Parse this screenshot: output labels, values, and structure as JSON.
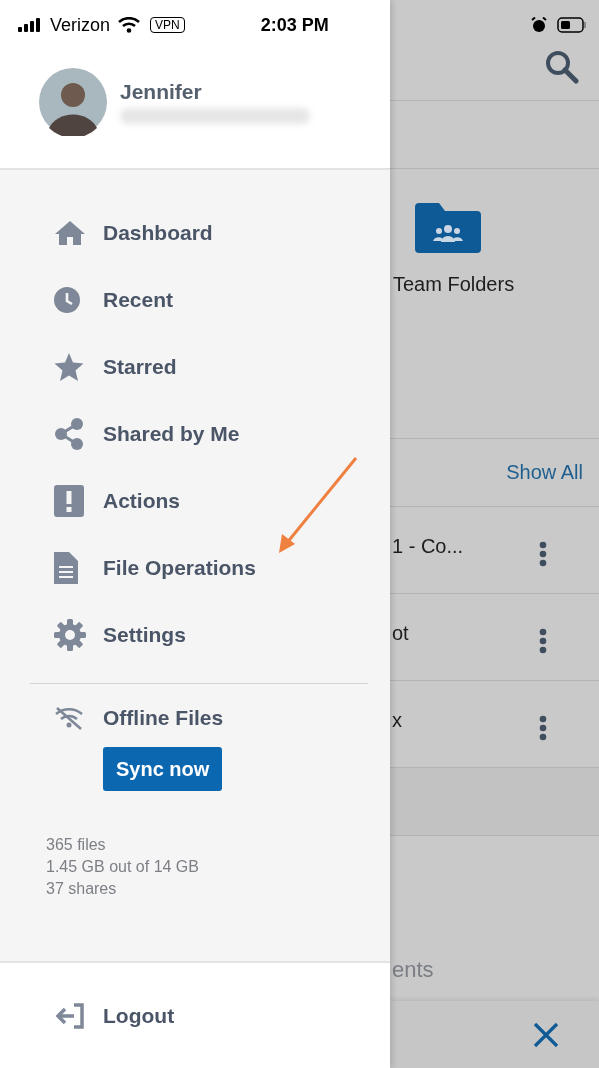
{
  "status_bar": {
    "carrier": "Verizon",
    "vpn": "VPN",
    "time": "2:03 PM"
  },
  "drawer": {
    "user_name": "Jennifer",
    "menu_items": [
      {
        "label": "Dashboard",
        "kind": "home"
      },
      {
        "label": "Recent",
        "kind": "clock"
      },
      {
        "label": "Starred",
        "kind": "star"
      },
      {
        "label": "Shared by Me",
        "kind": "share"
      },
      {
        "label": "Actions",
        "kind": "alert"
      },
      {
        "label": "File Operations",
        "kind": "file"
      },
      {
        "label": "Settings",
        "kind": "gear"
      }
    ],
    "offline": {
      "label": "Offline Files",
      "button": "Sync now"
    },
    "stats": [
      "365 files",
      "1.45 GB out of 14 GB",
      "37 shares"
    ],
    "logout": "Logout"
  },
  "background": {
    "folder_label": "Team Folders",
    "show_all": "Show All",
    "files": [
      "1 - Co...",
      "ot",
      "x"
    ],
    "partial_heading": "ents"
  }
}
